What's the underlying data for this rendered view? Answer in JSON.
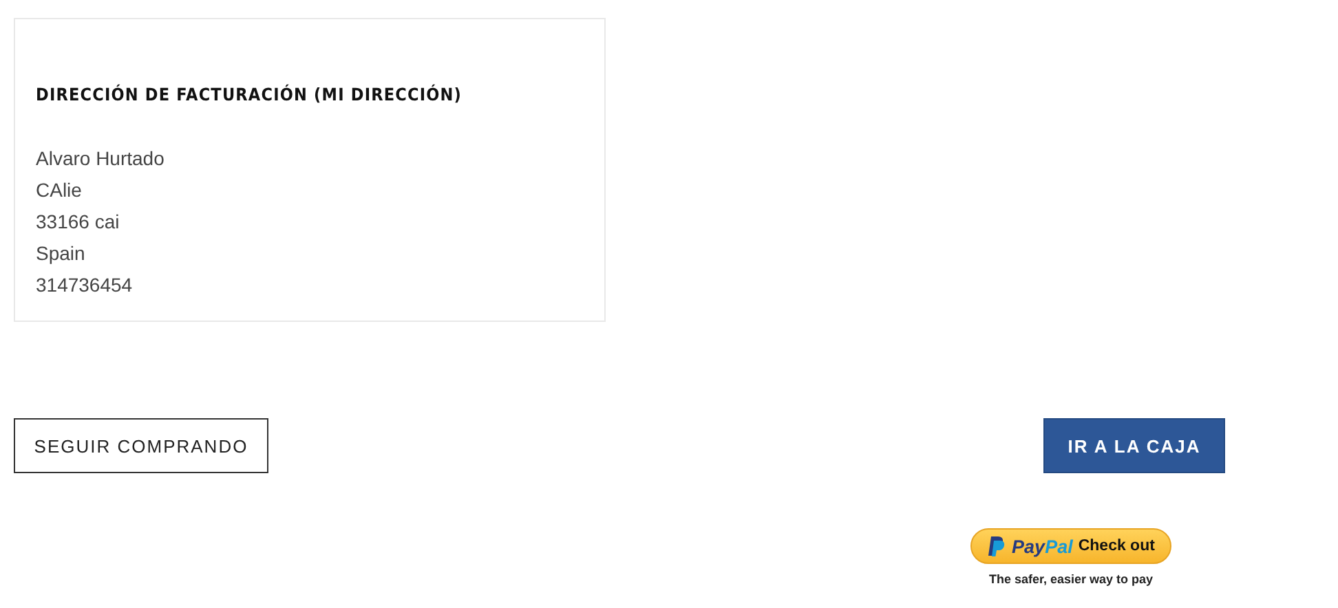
{
  "billing_address": {
    "title": "DIRECCIÓN DE FACTURACIÓN (MI DIRECCIÓN)",
    "lines": [
      "Alvaro Hurtado",
      "CAlie",
      "33166 cai",
      "Spain",
      "314736454"
    ]
  },
  "actions": {
    "continue_button": "SEGUIR COMPRANDO",
    "checkout_button": "IR A LA CAJA"
  },
  "paypal": {
    "brand_first": "Pay",
    "brand_second": "Pal",
    "label": "Check out",
    "tagline": "The safer, easier way to pay"
  }
}
